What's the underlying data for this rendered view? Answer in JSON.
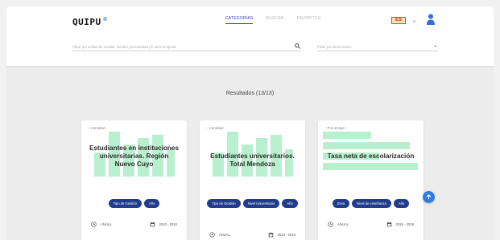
{
  "app": {
    "logo": "QUIPU"
  },
  "nav": [
    {
      "label": "CATEGORÍAS",
      "active": true
    },
    {
      "label": "BUSCAR",
      "active": false
    },
    {
      "label": "FAVORITOS",
      "active": false
    }
  ],
  "header": {
    "language_badge": "ES"
  },
  "search": {
    "placeholder": "Filtrar por unidad de medida, nombre, periodicidad y/o serie temporal"
  },
  "filter": {
    "placeholder": "Filtrar por dimensiones"
  },
  "results": {
    "title": "Resultados (13/13)"
  },
  "cards": [
    {
      "type": "Cantidad",
      "title": "Estudiantes en instituciones universitarias. Región Nuevo Cuyo",
      "tags": [
        "Tipo de Gestión",
        "Año"
      ],
      "periodicity": "ANUAL",
      "range": "2010 - 2018",
      "illustration": "bars"
    },
    {
      "type": "Cantidad",
      "title": "Estudiantes universitarios. Total Mendoza",
      "tags": [
        "Tipo de Gestión",
        "Nivel Universitario",
        "Año"
      ],
      "periodicity": "ANUAL",
      "range": "2010 - 2018",
      "illustration": "bars"
    },
    {
      "type": "Porcentaje",
      "title": "Tasa neta de escolarización",
      "tags": [
        "Zona",
        "Nivel de enseñanza",
        "Año"
      ],
      "periodicity": "ANUAL",
      "range": "2016 - 2019",
      "illustration": "hbars"
    }
  ],
  "colors": {
    "accent": "#213c8c",
    "illustration": "#b8f0cf",
    "fab": "#2f7de1"
  },
  "icons": {
    "search": "search-icon",
    "user": "user-icon",
    "clock": "clock-icon",
    "calendar": "calendar-icon",
    "scroll_top": "arrow-up-icon"
  }
}
